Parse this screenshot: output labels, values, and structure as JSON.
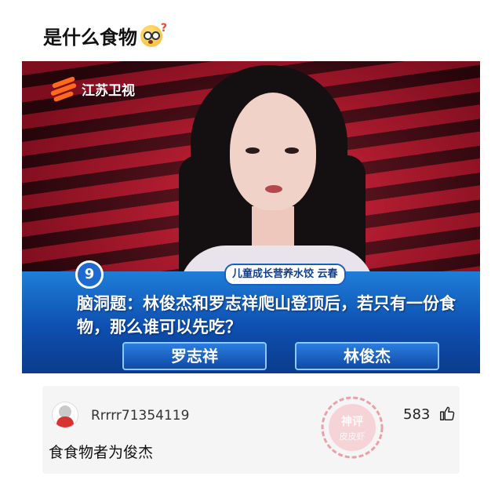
{
  "post": {
    "title": "是什么食物",
    "title_emoji": "thinking-face-emoji"
  },
  "video": {
    "channel": "江苏卫视",
    "question_number": "9",
    "sponsor": "儿童成长营养水饺 云春",
    "question": "脑洞题：林俊杰和罗志祥爬山登顶后，若只有一份食物，那么谁可以先吃？",
    "answers": [
      "罗志祥",
      "林俊杰"
    ]
  },
  "comment": {
    "username": "Rrrrr71354119",
    "likes": "583",
    "text": "食食物者为俊杰",
    "watermark": "神评 皮皮虾"
  },
  "colors": {
    "quiz_bar": "#0e4fb0",
    "background_red": "#c2162e",
    "watermark": "#e85a6a"
  }
}
